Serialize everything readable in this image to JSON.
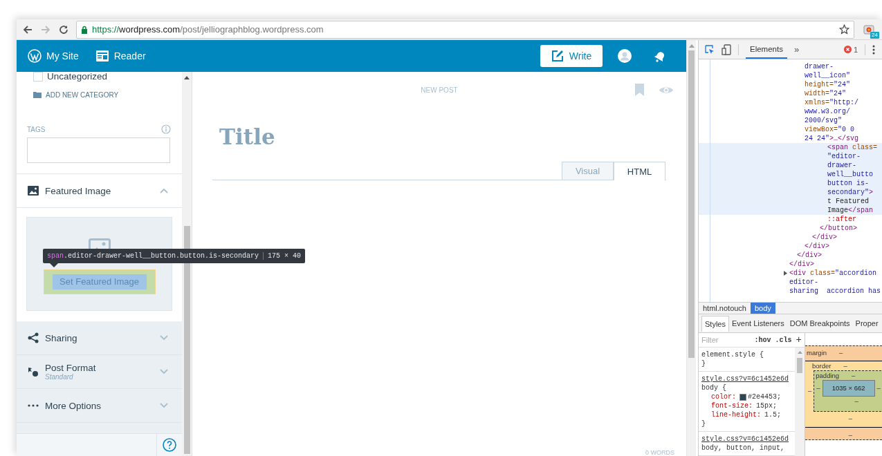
{
  "browser": {
    "url": {
      "scheme": "https://",
      "host": "wordpress.com",
      "path": "/post/jelliographblog.wordpress.com"
    },
    "extension_badge": "24"
  },
  "masterbar": {
    "items": [
      {
        "kind": "site",
        "label": "My Site"
      },
      {
        "kind": "reader",
        "label": "Reader"
      }
    ],
    "write_button": "Write"
  },
  "sidebar": {
    "categories": [
      {
        "label": "Uncategorized",
        "checked": false
      }
    ],
    "add_category": "ADD NEW CATEGORY",
    "tags": {
      "label": "TAGS"
    },
    "featured_image": {
      "title": "Featured Image",
      "expanded": true,
      "button": "Set Featured Image"
    },
    "sections": [
      {
        "kind": "sharing",
        "title": "Sharing",
        "expanded": false
      },
      {
        "kind": "format",
        "title": "Post Format",
        "subtitle": "Standard",
        "expanded": false
      },
      {
        "kind": "more",
        "title": "More Options",
        "expanded": false
      }
    ]
  },
  "inspector_tooltip": {
    "tag": "span",
    "classes": ".editor-drawer-well__button.button.is-secondary",
    "size": "175 × 40"
  },
  "editor": {
    "heading": "NEW POST",
    "title_placeholder": "Title",
    "tabs": [
      {
        "label": "Visual",
        "selected": false
      },
      {
        "label": "HTML",
        "selected": true
      }
    ],
    "word_count": "0 WORDS"
  },
  "devtools": {
    "tabs": [
      {
        "label": "Elements",
        "selected": true
      }
    ],
    "more_tabs": "»",
    "error_count": "1",
    "dom_tree": [
      {
        "selected": false,
        "closing": [
          [
            {
              "kind": "tag",
              "text": "</div>"
            }
          ]
        ],
        "children": [
          {
            "selected": false,
            "closing": [
              [
                {
                  "kind": "tag",
                  "text": "</div>"
                }
              ]
            ],
            "children": [
              {
                "selected": false,
                "lines": [
                  [
                    {
                      "kind": "value",
                      "text": "drawer-"
                    }
                  ],
                  [
                    {
                      "kind": "value",
                      "text": "well__icon\""
                    }
                  ],
                  [
                    {
                      "kind": "attr",
                      "text": "height="
                    },
                    {
                      "kind": "value",
                      "text": "\"24\""
                    }
                  ],
                  [
                    {
                      "kind": "attr",
                      "text": "width="
                    },
                    {
                      "kind": "value",
                      "text": "\"24\""
                    }
                  ],
                  [
                    {
                      "kind": "attr",
                      "text": "xmlns="
                    },
                    {
                      "kind": "value",
                      "text": "\"http:/"
                    }
                  ],
                  [
                    {
                      "kind": "value",
                      "text": "www.w3.org/"
                    }
                  ],
                  [
                    {
                      "kind": "value",
                      "text": "2000/svg\""
                    }
                  ],
                  [
                    {
                      "kind": "attr",
                      "text": "viewBox="
                    },
                    {
                      "kind": "value",
                      "text": "\"0 0"
                    }
                  ],
                  [
                    {
                      "kind": "value",
                      "text": "24 24\""
                    },
                    {
                      "kind": "tag",
                      "text": ">…</svg"
                    }
                  ]
                ]
              },
              {
                "selected": false,
                "closing": [
                  [
                    {
                      "kind": "tag",
                      "text": "</div>"
                    }
                  ]
                ],
                "children": [
                  {
                    "selected": false,
                    "closing": [
                      [
                        {
                          "kind": "tag",
                          "text": "</div>"
                        }
                      ]
                    ],
                    "children": [
                      {
                        "selected": false,
                        "closing": [
                          [
                            {
                              "kind": "tag",
                              "text": "</button>"
                            }
                          ]
                        ],
                        "children": [
                          {
                            "selected": true,
                            "lines": [
                              [
                                {
                                  "kind": "tag",
                                  "text": "<span"
                                },
                                {
                                  "kind": "attr",
                                  "text": " class="
                                }
                              ],
                              [
                                {
                                  "kind": "value",
                                  "text": "\"editor-"
                                }
                              ],
                              [
                                {
                                  "kind": "value",
                                  "text": "drawer-"
                                }
                              ],
                              [
                                {
                                  "kind": "value",
                                  "text": "well__butto"
                                }
                              ],
                              [
                                {
                                  "kind": "value",
                                  "text": "button is-"
                                }
                              ],
                              [
                                {
                                  "kind": "value",
                                  "text": "secondary\""
                                },
                                {
                                  "kind": "tag",
                                  "text": ">"
                                }
                              ],
                              [
                                {
                                  "kind": "text",
                                  "text": "t Featured"
                                }
                              ],
                              [
                                {
                                  "kind": "text",
                                  "text": "Image"
                                },
                                {
                                  "kind": "tag",
                                  "text": "</span"
                                }
                              ]
                            ]
                          },
                          {
                            "selected": false,
                            "lines": [
                              [
                                {
                                  "kind": "pseudo",
                                  "text": "::after"
                                }
                              ]
                            ]
                          }
                        ]
                      }
                    ]
                  }
                ]
              }
            ]
          }
        ]
      },
      {
        "selected": false,
        "expanded": false,
        "lines": [
          [
            {
              "kind": "tag",
              "text": "<div"
            },
            {
              "kind": "attr",
              "text": " class="
            },
            {
              "kind": "value",
              "text": "\"accordion"
            }
          ],
          [
            {
              "kind": "value",
              "text": "editor-"
            }
          ],
          [
            {
              "kind": "value",
              "text": "sharing  accordion has"
            }
          ]
        ]
      }
    ],
    "breadcrumbs": [
      {
        "label": "html.notouch",
        "selected": false
      },
      {
        "label": "body",
        "selected": true
      }
    ],
    "style_tabs": [
      {
        "label": "Styles",
        "selected": true
      },
      {
        "label": "Event Listeners",
        "selected": false
      },
      {
        "label": "DOM Breakpoints",
        "selected": false
      },
      {
        "label": "Proper",
        "selected": false
      }
    ],
    "filter": {
      "placeholder": "Filter"
    },
    "filter_buttons": [
      ":hov",
      ".cls",
      "+"
    ],
    "rules": [
      {
        "selector": "element.style {",
        "close": "}"
      },
      {
        "source": "style.css?v=6c1452e6d",
        "selector": "body {",
        "declarations": [
          {
            "property": "color:",
            "value": "#2e4453;",
            "color": "#2e4453"
          },
          {
            "property": "font-size:",
            "value": "15px;"
          },
          {
            "property": "line-height:",
            "value": "1.5;"
          }
        ],
        "close": "}"
      },
      {
        "source": "style.css?v=6c1452e6d",
        "selector": "body, button, input,"
      }
    ],
    "box_model": {
      "margin": {
        "label": "margin",
        "top": "–",
        "bottom": "–"
      },
      "border": {
        "label": "border",
        "top": "–",
        "bottom": "–",
        "left": "–"
      },
      "padding": {
        "label": "padding",
        "top": "–",
        "bottom": "–",
        "left": "–",
        "right": "–"
      },
      "content": "1035 × 662"
    }
  }
}
